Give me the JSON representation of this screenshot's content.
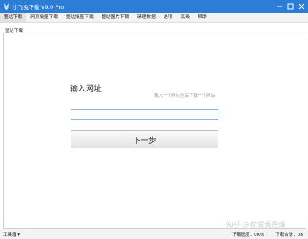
{
  "window": {
    "title": "小飞兔下载 V9.0 Pro",
    "controls": [
      "minimize-icon",
      "maximize-icon",
      "close-icon"
    ]
  },
  "menu": {
    "items": [
      "整站下载",
      "网页批量下载",
      "整站批量下载",
      "整站图片下载",
      "清理数据",
      "选项",
      "高级",
      "帮助"
    ],
    "active_index": 0
  },
  "panel": {
    "tab_label": "整站下载",
    "heading": "输入网址",
    "hint": "输入一个网址然后下载一个网站",
    "url_value": "",
    "url_placeholder": "",
    "next_label": "下一步"
  },
  "status": {
    "toolbox_label": "工具箱 ▾",
    "speed": "下载速度：0K/s",
    "total": "下载合计：0B"
  },
  "watermark": "知乎 @你爱我是谁",
  "colors": {
    "titlebar": "#2b7dd6",
    "input_border": "#8fb5e0"
  }
}
